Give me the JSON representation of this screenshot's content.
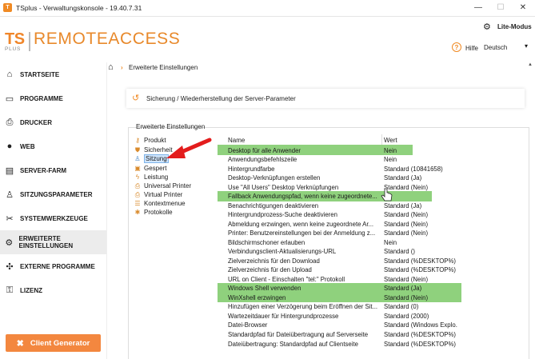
{
  "window": {
    "title": "TSplus - Verwaltungskonsole - 19.40.7.31",
    "minimize": "—",
    "maximize": "☐",
    "close": "✕"
  },
  "header": {
    "logo_ts": "TS",
    "logo_plus": "PLUS",
    "logo_brand": "REMOTEACCESS",
    "lite_mode": "Lite-Modus",
    "help": "Hilfe",
    "help_glyph": "?",
    "language": "Deutsch"
  },
  "sidebar": {
    "items": [
      {
        "label": "STARTSEITE",
        "icon": "home-icon"
      },
      {
        "label": "PROGRAMME",
        "icon": "window-icon"
      },
      {
        "label": "DRUCKER",
        "icon": "printer-icon"
      },
      {
        "label": "WEB",
        "icon": "globe-icon"
      },
      {
        "label": "SERVER-FARM",
        "icon": "server-icon"
      },
      {
        "label": "SITZUNGSPARAMETER",
        "icon": "user-icon"
      },
      {
        "label": "SYSTEMWERKZEUGE",
        "icon": "tools-icon"
      },
      {
        "label": "ERWEITERTE EINSTELLUNGEN",
        "icon": "gear-icon"
      },
      {
        "label": "EXTERNE PROGRAMME",
        "icon": "puzzle-icon"
      },
      {
        "label": "LIZENZ",
        "icon": "key-icon"
      }
    ],
    "active_index": 7,
    "client_generator": "Client Generator"
  },
  "breadcrumb": {
    "current": "Erweiterte Einstellungen"
  },
  "info": {
    "text": "Sicherung / Wiederherstellung der Server-Parameter"
  },
  "group": {
    "label": "Erweiterte Einstellungen"
  },
  "tree": {
    "items": [
      "Produkt",
      "Sicherheit",
      "Sitzung",
      "Gespert",
      "Leistung",
      "Universal Printer",
      "Virtual Printer",
      "Kontextmenue",
      "Protokolle"
    ],
    "selected_index": 2
  },
  "table": {
    "headers": {
      "name": "Name",
      "value": "Wert"
    },
    "rows": [
      {
        "name": "Desktop für alle Anwender",
        "value": "Nein",
        "highlight": true
      },
      {
        "name": "Anwendungsbefehlszeile",
        "value": "Nein"
      },
      {
        "name": "Hintergrundfarbe",
        "value": "Standard (10841658)"
      },
      {
        "name": "Desktop-Verknüpfungen erstellen",
        "value": "Standard (Ja)"
      },
      {
        "name": "Use \"All Users\" Desktop Verknüpfungen",
        "value": "Standard (Nein)"
      },
      {
        "name": "Fallback Anwendungspfad, wenn keine zugeordnete...",
        "value": "",
        "highlight": true
      },
      {
        "name": "Benachrichtigungen deaktivieren",
        "value": "Standard (Ja)"
      },
      {
        "name": "Hintergrundprozess-Suche deaktivieren",
        "value": "Standard (Nein)"
      },
      {
        "name": "Abmeldung erzwingen, wenn keine zugeordnete Ar...",
        "value": "Standard (Nein)"
      },
      {
        "name": "Printer: Benutzereinstellungen bei der Anmeldung z...",
        "value": "Standard (Nein)"
      },
      {
        "name": "Bildschirmschoner erlauben",
        "value": "Nein"
      },
      {
        "name": "Verbindungsclient-Aktualisierungs-URL",
        "value": "Standard ()"
      },
      {
        "name": "Zielverzeichnis für den Download",
        "value": "Standard (%DESKTOP%)"
      },
      {
        "name": "Zielverzeichnis für den Upload",
        "value": "Standard (%DESKTOP%)"
      },
      {
        "name": "URL on Client - Einschalten \"tel:\" Protokoll",
        "value": "Standard (Nein)"
      },
      {
        "name": "Windows Shell verwenden",
        "value": "Standard (Ja)",
        "highlight": true
      },
      {
        "name": "WinXshell erzwingen",
        "value": "Standard (Nein)",
        "highlight": true
      },
      {
        "name": "Hinzufügen einer Verzögerung beim Eröffnen der Sit...",
        "value": "Standard (0)"
      },
      {
        "name": "Wartezeitdauer für Hintergrundprozesse",
        "value": "Standard (2000)"
      },
      {
        "name": "Datei-Browser",
        "value": "Standard (Windows Explo..."
      },
      {
        "name": "Standardpfad für Dateiübertragung auf Serverseite",
        "value": "Standard (%DESKTOP%)"
      },
      {
        "name": "Dateiübertragung: Standardpfad auf Clientseite",
        "value": "Standard (%DESKTOP%)"
      }
    ]
  },
  "colors": {
    "accent": "#f08a24",
    "highlight": "#8fd17d",
    "arrow": "#e31c1c",
    "selected_bg": "#cfe4fb"
  }
}
